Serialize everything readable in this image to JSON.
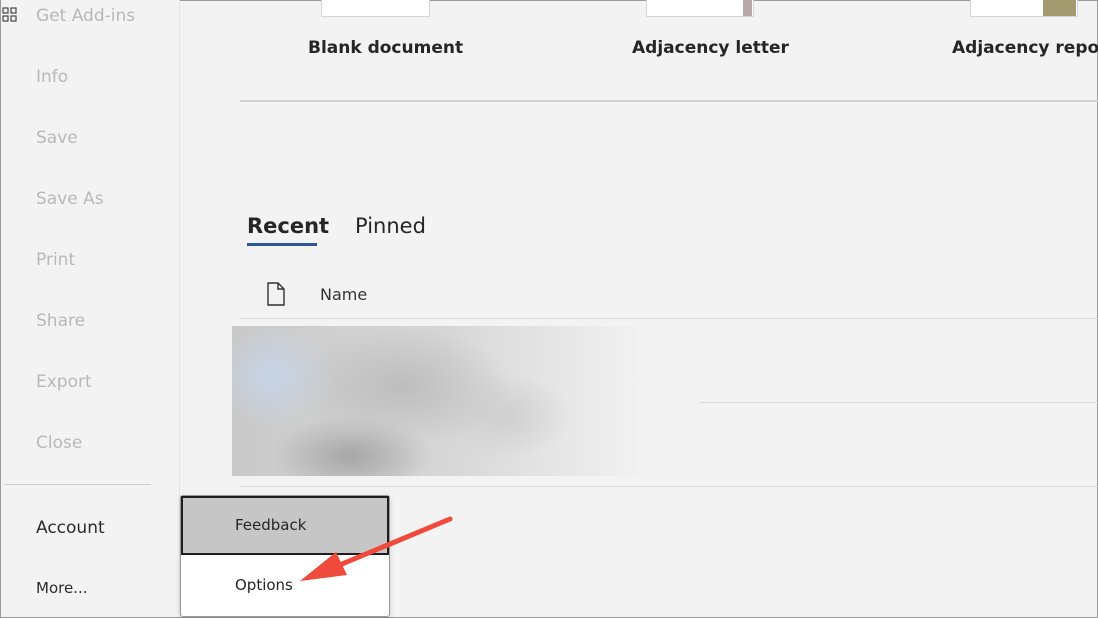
{
  "sidebar": {
    "items": [
      {
        "label": "Get Add-ins",
        "icon": "grid-icon"
      },
      {
        "label": "Info"
      },
      {
        "label": "Save"
      },
      {
        "label": "Save As"
      },
      {
        "label": "Print"
      },
      {
        "label": "Share"
      },
      {
        "label": "Export"
      },
      {
        "label": "Close"
      }
    ],
    "account_label": "Account",
    "more_label": "More..."
  },
  "templates": [
    {
      "label": "Blank document"
    },
    {
      "label": "Adjacency letter"
    },
    {
      "label": "Adjacency report"
    }
  ],
  "tabs": [
    {
      "label": "Recent",
      "active": true
    },
    {
      "label": "Pinned",
      "active": false
    }
  ],
  "file_list": {
    "column_name": "Name",
    "column_icon": "document-icon"
  },
  "popup_menu": {
    "items": [
      {
        "label": "Feedback",
        "state": "hover"
      },
      {
        "label": "Options"
      }
    ]
  },
  "colors": {
    "accent": "#2b579a",
    "annotation_arrow": "#ef4a3c",
    "disabled_text": "#b8b8b8"
  }
}
